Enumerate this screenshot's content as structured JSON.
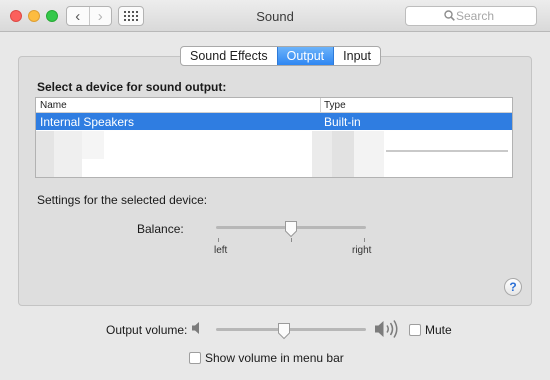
{
  "window": {
    "title": "Sound"
  },
  "toolbar": {
    "back_icon": "chevron-left-icon",
    "forward_icon": "chevron-right-icon",
    "show_all_icon": "grid-icon"
  },
  "search": {
    "placeholder": "Search",
    "value": ""
  },
  "tabs": [
    {
      "label": "Sound Effects",
      "active": false
    },
    {
      "label": "Output",
      "active": true
    },
    {
      "label": "Input",
      "active": false
    }
  ],
  "output": {
    "heading": "Select a device for sound output:",
    "columns": [
      "Name",
      "Type"
    ],
    "devices": [
      {
        "name": "Internal Speakers",
        "type": "Built-in",
        "selected": true
      }
    ],
    "settings_label": "Settings for the selected device:",
    "balance": {
      "label": "Balance:",
      "left_label": "left",
      "right_label": "right",
      "value": 0.5
    },
    "help_label": "?"
  },
  "volume": {
    "label": "Output volume:",
    "value": 0.45,
    "mute_label": "Mute",
    "mute_checked": false,
    "show_in_menubar_label": "Show volume in menu bar",
    "show_in_menubar_checked": false
  },
  "colors": {
    "accent": "#2f7de1",
    "close": "#fc605c",
    "minimize": "#fdbc40",
    "maximize": "#34c84a"
  }
}
